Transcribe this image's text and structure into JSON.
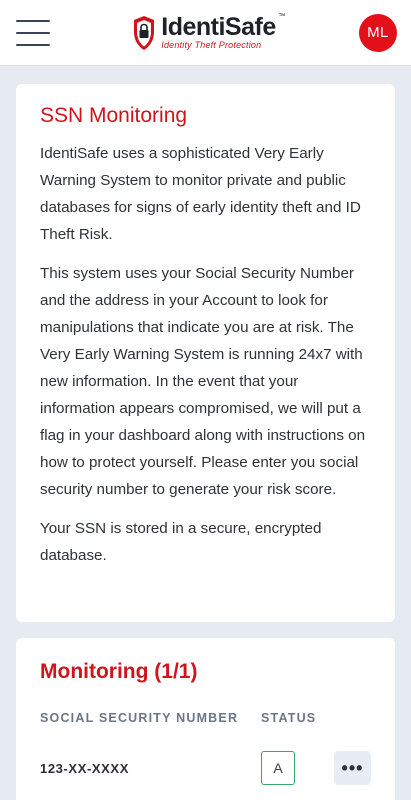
{
  "header": {
    "brand_name": "IdentiSafe",
    "brand_tm": "™",
    "brand_tagline": "Identity Theft Protection",
    "avatar_initials": "ML",
    "accent_color": "#e3101a"
  },
  "ssn_card": {
    "title": "SSN Monitoring",
    "paragraphs": [
      "IdentiSafe uses a sophisticated Very Early Warning System to monitor private and public databases for signs of early identity theft and ID Theft Risk.",
      "This system uses your Social Security Number and the address in your Account to look for manipulations that indicate you are at risk. The Very Early Warning System is running 24x7 with new information. In the event that your information appears compromised, we will put a flag in your dashboard along with instructions on how to protect yourself. Please enter you social security number to generate your risk score.",
      "Your SSN is stored in a secure, encrypted database."
    ]
  },
  "monitoring": {
    "title": "Monitoring (1/1)",
    "columns": [
      "SOCIAL SECURITY NUMBER",
      "STATUS"
    ],
    "rows": [
      {
        "ssn": "123-XX-XXXX",
        "status": "A",
        "more_icon": "more-horizontal-icon",
        "more_label": "•••"
      }
    ]
  }
}
